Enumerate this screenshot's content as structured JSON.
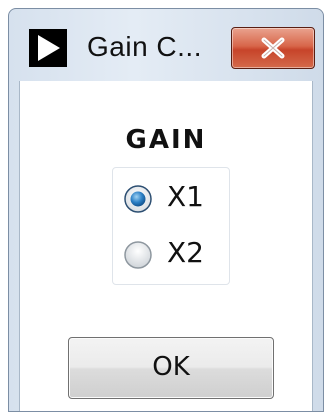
{
  "window": {
    "title": "Gain C...",
    "accent_close_color": "#c7442a"
  },
  "gain": {
    "label": "GAIN",
    "options": [
      {
        "label": "X1",
        "selected": true
      },
      {
        "label": "X2",
        "selected": false
      }
    ]
  },
  "buttons": {
    "ok_label": "OK"
  },
  "icons": {
    "app": "play-triangle-icon",
    "close": "close-icon"
  }
}
